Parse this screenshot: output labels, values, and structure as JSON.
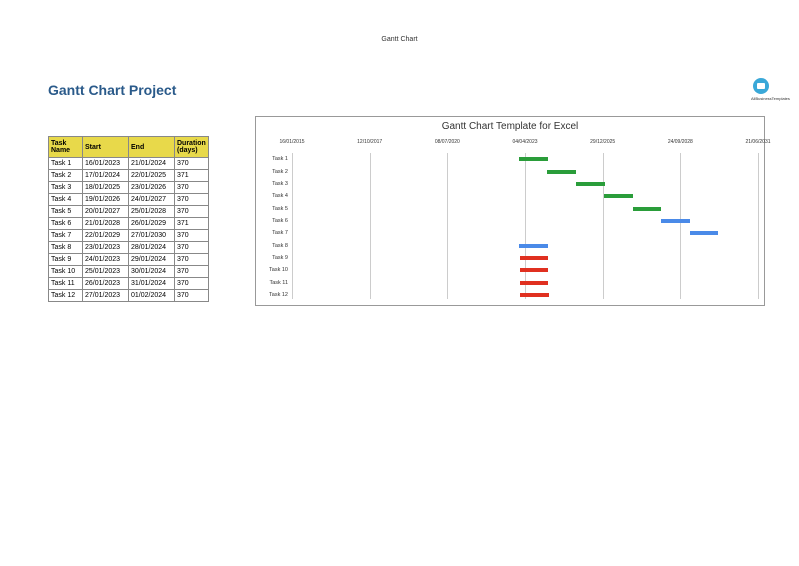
{
  "header_label": "Gantt Chart",
  "page_title": "Gantt Chart Project",
  "logo_text": "AllBusinessTemplates",
  "table": {
    "headers": [
      "Task Name",
      "Start",
      "End",
      "Duration (days)"
    ],
    "rows": [
      [
        "Task 1",
        "16/01/2023",
        "21/01/2024",
        "370"
      ],
      [
        "Task 2",
        "17/01/2024",
        "22/01/2025",
        "371"
      ],
      [
        "Task 3",
        "18/01/2025",
        "23/01/2026",
        "370"
      ],
      [
        "Task 4",
        "19/01/2026",
        "24/01/2027",
        "370"
      ],
      [
        "Task 5",
        "20/01/2027",
        "25/01/2028",
        "370"
      ],
      [
        "Task 6",
        "21/01/2028",
        "26/01/2029",
        "371"
      ],
      [
        "Task 7",
        "22/01/2029",
        "27/01/2030",
        "370"
      ],
      [
        "Task 8",
        "23/01/2023",
        "28/01/2024",
        "370"
      ],
      [
        "Task 9",
        "24/01/2023",
        "29/01/2024",
        "370"
      ],
      [
        "Task 10",
        "25/01/2023",
        "30/01/2024",
        "370"
      ],
      [
        "Task 11",
        "26/01/2023",
        "31/01/2024",
        "370"
      ],
      [
        "Task 12",
        "27/01/2023",
        "01/02/2024",
        "370"
      ]
    ]
  },
  "chart_data": {
    "type": "bar",
    "title": "Gantt Chart Template for Excel",
    "x_ticks": [
      "16/01/2015",
      "12/10/2017",
      "08/07/2020",
      "04/04/2023",
      "29/12/2025",
      "24/09/2028",
      "21/06/2031"
    ],
    "categories": [
      "Task 1",
      "Task 2",
      "Task 3",
      "Task 4",
      "Task 5",
      "Task 6",
      "Task 7",
      "Task 8",
      "Task 9",
      "Task 10",
      "Task 11",
      "Task 12"
    ],
    "series": [
      {
        "name": "Task 1",
        "start": "16/01/2023",
        "end": "21/01/2024",
        "color": "green"
      },
      {
        "name": "Task 2",
        "start": "17/01/2024",
        "end": "22/01/2025",
        "color": "green"
      },
      {
        "name": "Task 3",
        "start": "18/01/2025",
        "end": "23/01/2026",
        "color": "green"
      },
      {
        "name": "Task 4",
        "start": "19/01/2026",
        "end": "24/01/2027",
        "color": "green"
      },
      {
        "name": "Task 5",
        "start": "20/01/2027",
        "end": "25/01/2028",
        "color": "green"
      },
      {
        "name": "Task 6",
        "start": "21/01/2028",
        "end": "26/01/2029",
        "color": "blue"
      },
      {
        "name": "Task 7",
        "start": "22/01/2029",
        "end": "27/01/2030",
        "color": "blue"
      },
      {
        "name": "Task 8",
        "start": "23/01/2023",
        "end": "28/01/2024",
        "color": "blue"
      },
      {
        "name": "Task 9",
        "start": "24/01/2023",
        "end": "29/01/2024",
        "color": "red"
      },
      {
        "name": "Task 10",
        "start": "25/01/2023",
        "end": "30/01/2024",
        "color": "red"
      },
      {
        "name": "Task 11",
        "start": "26/01/2023",
        "end": "31/01/2024",
        "color": "red"
      },
      {
        "name": "Task 12",
        "start": "27/01/2023",
        "end": "01/02/2024",
        "color": "red"
      }
    ],
    "colors": {
      "green": "#2a9d3a",
      "blue": "#4a8ae8",
      "red": "#e03020"
    }
  }
}
